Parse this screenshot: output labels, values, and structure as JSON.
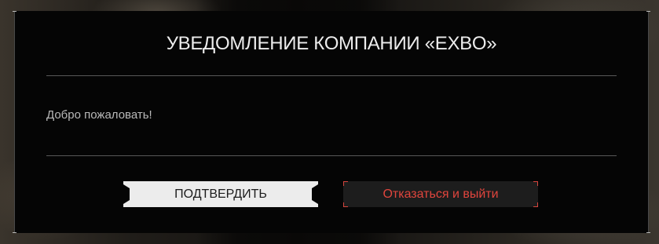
{
  "dialog": {
    "title": "УВЕДОМЛЕНИЕ КОМПАНИИ «EXBO»",
    "message": "Добро пожаловать!",
    "confirm_label": "ПОДТВЕРДИТЬ",
    "decline_label": "Отказаться и выйти"
  },
  "colors": {
    "dialog_background": "#050505",
    "confirm_background": "#ececec",
    "decline_text": "#e0453d",
    "decline_background": "#1d1d1d"
  }
}
